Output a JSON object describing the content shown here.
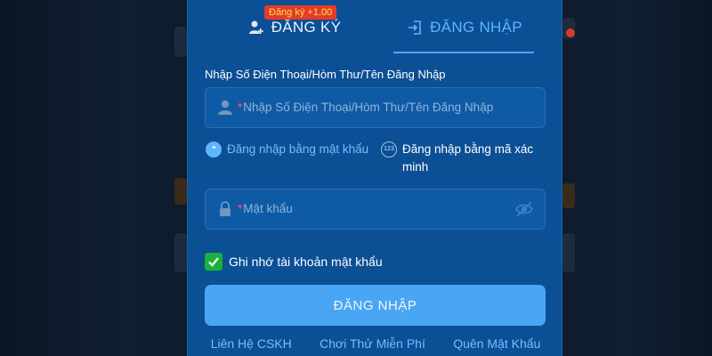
{
  "tabs": {
    "register": {
      "label": "ĐĂNG KÝ",
      "badge": "Đăng ký +1.00"
    },
    "login": {
      "label": "ĐĂNG NHẬP"
    }
  },
  "account_field": {
    "label": "Nhập Số Điện Thoại/Hòm Thư/Tên Đăng Nhập",
    "required_mark": "*",
    "placeholder": "Nhập Số Điện Thoại/Hòm Thư/Tên Đăng Nhập"
  },
  "login_modes": {
    "password": {
      "label": "Đăng nhập bằng mật khẩu",
      "icon_text": "**"
    },
    "otp": {
      "label": "Đăng nhập bằng mã xác minh",
      "icon_text": "123"
    }
  },
  "password_field": {
    "required_mark": "*",
    "placeholder": "Mật khẩu"
  },
  "remember": {
    "label": "Ghi nhớ tài khoản mật khẩu",
    "checked": true
  },
  "login_button": {
    "label": "ĐĂNG NHẬP"
  },
  "footer": {
    "support": "Liên Hệ CSKH",
    "trial": "Chơi Thử Miễn Phí",
    "forgot": "Quên Mật Khẩu"
  },
  "icons": {
    "register_tab": "user-plus-icon",
    "login_tab": "login-door-icon",
    "account_input": "user-icon",
    "password_input": "lock-icon",
    "password_visibility": "eye-off-icon",
    "remember": "checkmark-icon"
  },
  "colors": {
    "modal_bg": "#0b4f95",
    "accent": "#4aa8ff",
    "button": "#4aa6f5",
    "badge_bg": "#e43c2a",
    "badge_text": "#ffe14a",
    "checkbox": "#19b13b"
  }
}
